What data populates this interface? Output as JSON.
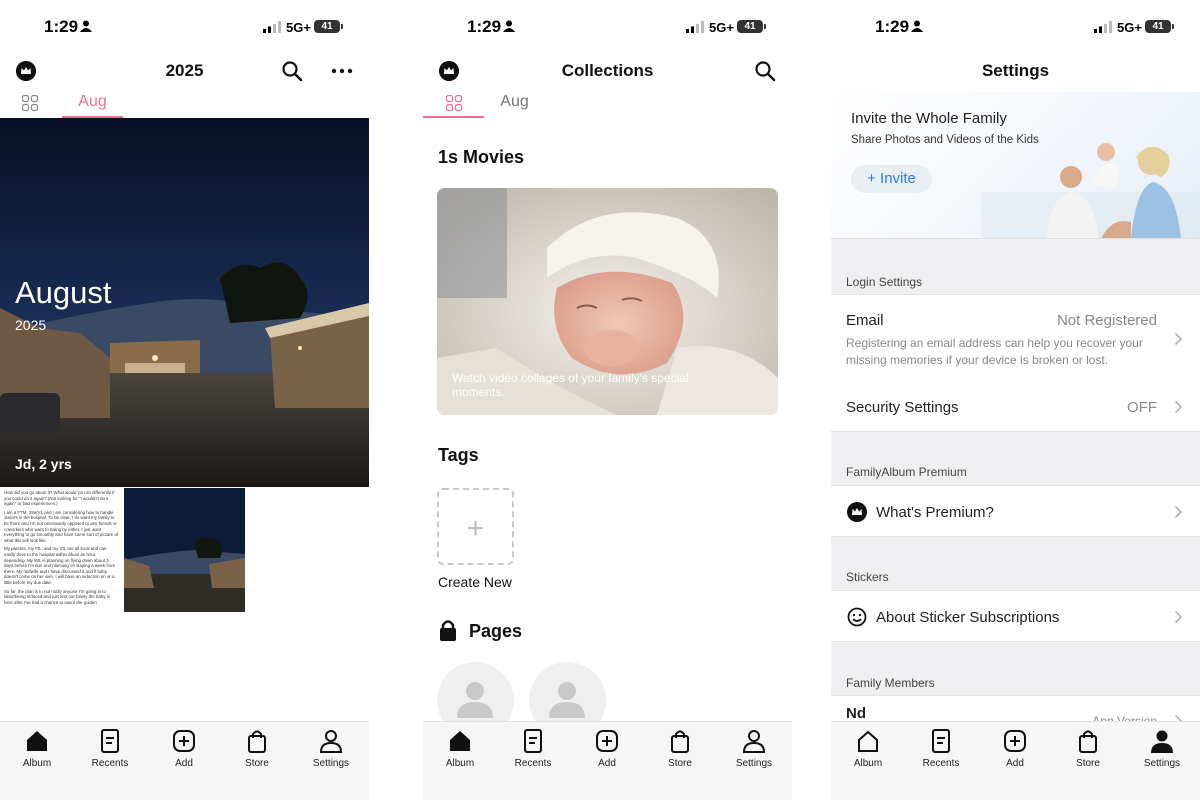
{
  "status": {
    "time": "1:29",
    "network": "5G+",
    "battery": "41"
  },
  "tabbar": {
    "items": [
      {
        "label": "Album"
      },
      {
        "label": "Recents"
      },
      {
        "label": "Add"
      },
      {
        "label": "Store"
      },
      {
        "label": "Settings"
      }
    ]
  },
  "album": {
    "title": "2025",
    "tab_label": "Aug",
    "hero": {
      "month": "August",
      "year": "2025",
      "name": "Jd, 2 yrs"
    },
    "note_paragraphs": [
      "How did you go about it? What would you do differently if you could do it again? (Not looking for \"I wouldn't do it again\" or bad experiences.)",
      "I am a FTM, 28w?d, and I am considering how to handle visitors in the hospital. To be clear, I do want my family to be there and I'm not necessarily opposed to any friends or coworkers who want to swing by either, I just want everything to go smoothly and have some sort of picture of what this will look like.",
      "My parents, my FIL, and my SIL are all local and can easily drive to the hospital within about an hour, depending. My MIL is planning on flying down about 3 days before I'm due and planning on staying a week from there. My midwife and I have discussed it and if baby doesn't come on her own, I will have an induction on or a little before my due date.",
      "So far, the plan is to not notify anyone I'm going in to labor/being induced and just text our family the baby is here after I've had a chance to savor the golden"
    ]
  },
  "collections": {
    "title": "Collections",
    "tab_label": "Aug",
    "movies_title": "1s Movies",
    "movies_caption": "Watch video collages of your family's special moments.",
    "tags_title": "Tags",
    "create_new": "Create New",
    "pages_title": "Pages"
  },
  "settings": {
    "title": "Settings",
    "invite": {
      "title": "Invite the Whole Family",
      "subtitle": "Share Photos and Videos of the Kids",
      "button": "+ Invite"
    },
    "login_group": "Login Settings",
    "email": {
      "label": "Email",
      "value": "Not Registered",
      "description": "Registering an email address can help you recover your missing memories if your device is broken or lost."
    },
    "security": {
      "label": "Security Settings",
      "value": "OFF"
    },
    "premium_group": "FamilyAlbum Premium",
    "whats_premium": "What's Premium?",
    "stickers_group": "Stickers",
    "about_stickers": "About Sticker Subscriptions",
    "members_group": "Family Members",
    "member_name": "Nd",
    "member_value": "App Version"
  },
  "colors": {
    "accent": "#f06c8c",
    "link": "#2b7de9",
    "grouped_bg": "#efeff1"
  }
}
